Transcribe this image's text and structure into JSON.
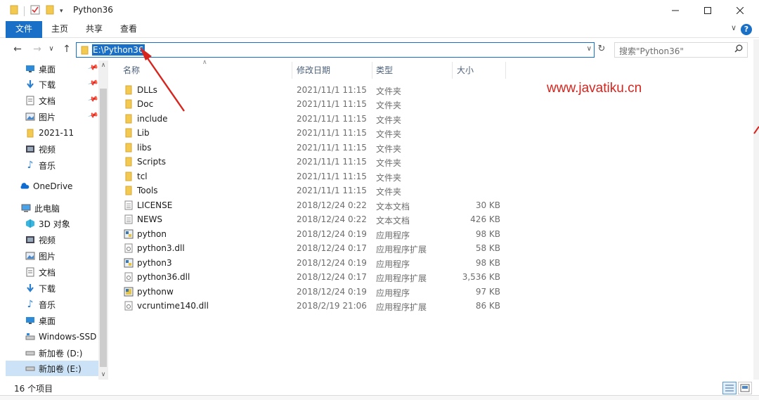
{
  "window": {
    "title": "Python36"
  },
  "ribbon": {
    "tabs": [
      "文件",
      "主页",
      "共享",
      "查看"
    ]
  },
  "address": {
    "path": "E:\\Python36"
  },
  "search": {
    "placeholder": "搜索\"Python36\""
  },
  "sidebar": {
    "items": [
      {
        "label": "桌面",
        "icon": "desktop-icon",
        "pinned": true
      },
      {
        "label": "下载",
        "icon": "download-icon",
        "pinned": true
      },
      {
        "label": "文档",
        "icon": "document-icon",
        "pinned": true
      },
      {
        "label": "图片",
        "icon": "picture-icon",
        "pinned": true
      },
      {
        "label": "2021-11",
        "icon": "folder-icon",
        "pinned": false
      },
      {
        "label": "视频",
        "icon": "video-icon",
        "pinned": false
      },
      {
        "label": "音乐",
        "icon": "music-icon",
        "pinned": false
      },
      {
        "label": "OneDrive",
        "icon": "cloud-icon",
        "pinned": false
      },
      {
        "label": "此电脑",
        "icon": "computer-icon",
        "pinned": false
      },
      {
        "label": "3D 对象",
        "icon": "3d-objects-icon",
        "pinned": false
      },
      {
        "label": "视频",
        "icon": "video-icon",
        "pinned": false
      },
      {
        "label": "图片",
        "icon": "picture-icon",
        "pinned": false
      },
      {
        "label": "文档",
        "icon": "document-icon",
        "pinned": false
      },
      {
        "label": "下载",
        "icon": "download-icon",
        "pinned": false
      },
      {
        "label": "音乐",
        "icon": "music-icon",
        "pinned": false
      },
      {
        "label": "桌面",
        "icon": "desktop-icon",
        "pinned": false
      },
      {
        "label": "Windows-SSD (",
        "icon": "drive-icon",
        "pinned": false
      },
      {
        "label": "新加卷 (D:)",
        "icon": "drive-icon",
        "pinned": false
      },
      {
        "label": "新加卷 (E:)",
        "icon": "drive-icon",
        "pinned": false,
        "selected": true
      }
    ]
  },
  "columns": {
    "name": "名称",
    "date": "修改日期",
    "type": "类型",
    "size": "大小"
  },
  "files": [
    {
      "name": "DLLs",
      "date": "2021/11/1 11:15",
      "type": "文件夹",
      "size": "",
      "icon": "folder-icon"
    },
    {
      "name": "Doc",
      "date": "2021/11/1 11:15",
      "type": "文件夹",
      "size": "",
      "icon": "folder-icon"
    },
    {
      "name": "include",
      "date": "2021/11/1 11:15",
      "type": "文件夹",
      "size": "",
      "icon": "folder-icon"
    },
    {
      "name": "Lib",
      "date": "2021/11/1 11:15",
      "type": "文件夹",
      "size": "",
      "icon": "folder-icon"
    },
    {
      "name": "libs",
      "date": "2021/11/1 11:15",
      "type": "文件夹",
      "size": "",
      "icon": "folder-icon"
    },
    {
      "name": "Scripts",
      "date": "2021/11/1 11:15",
      "type": "文件夹",
      "size": "",
      "icon": "folder-icon"
    },
    {
      "name": "tcl",
      "date": "2021/11/1 11:15",
      "type": "文件夹",
      "size": "",
      "icon": "folder-icon"
    },
    {
      "name": "Tools",
      "date": "2021/11/1 11:15",
      "type": "文件夹",
      "size": "",
      "icon": "folder-icon"
    },
    {
      "name": "LICENSE",
      "date": "2018/12/24 0:22",
      "type": "文本文档",
      "size": "30 KB",
      "icon": "text-file-icon"
    },
    {
      "name": "NEWS",
      "date": "2018/12/24 0:22",
      "type": "文本文档",
      "size": "426 KB",
      "icon": "text-file-icon"
    },
    {
      "name": "python",
      "date": "2018/12/24 0:19",
      "type": "应用程序",
      "size": "98 KB",
      "icon": "python-exe-icon"
    },
    {
      "name": "python3.dll",
      "date": "2018/12/24 0:17",
      "type": "应用程序扩展",
      "size": "58 KB",
      "icon": "dll-file-icon"
    },
    {
      "name": "python3",
      "date": "2018/12/24 0:19",
      "type": "应用程序",
      "size": "98 KB",
      "icon": "python-exe-icon"
    },
    {
      "name": "python36.dll",
      "date": "2018/12/24 0:17",
      "type": "应用程序扩展",
      "size": "3,536 KB",
      "icon": "dll-file-icon"
    },
    {
      "name": "pythonw",
      "date": "2018/12/24 0:19",
      "type": "应用程序",
      "size": "97 KB",
      "icon": "pythonw-exe-icon"
    },
    {
      "name": "vcruntime140.dll",
      "date": "2018/2/19 21:06",
      "type": "应用程序扩展",
      "size": "86 KB",
      "icon": "dll-file-icon"
    }
  ],
  "status": {
    "item_count": "16 个项目"
  },
  "watermark": "www.javatiku.cn",
  "colors": {
    "accent": "#1a6fc7",
    "selection": "#cce3f7",
    "folder": "#f3c94f",
    "annotation": "#d7251e"
  }
}
